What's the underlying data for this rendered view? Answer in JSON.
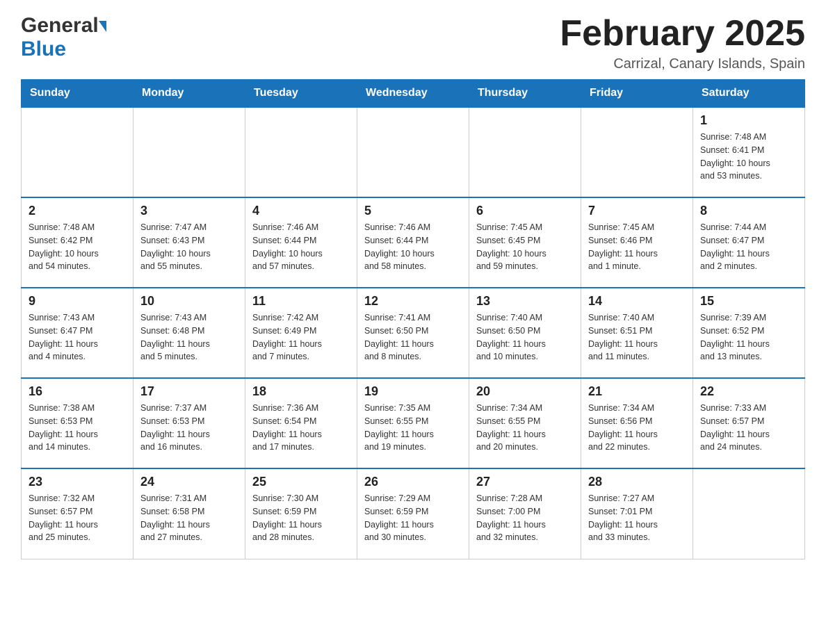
{
  "header": {
    "logo_general": "General",
    "logo_blue": "Blue",
    "title": "February 2025",
    "subtitle": "Carrizal, Canary Islands, Spain"
  },
  "days_of_week": [
    "Sunday",
    "Monday",
    "Tuesday",
    "Wednesday",
    "Thursday",
    "Friday",
    "Saturday"
  ],
  "weeks": [
    [
      {
        "day": "",
        "info": ""
      },
      {
        "day": "",
        "info": ""
      },
      {
        "day": "",
        "info": ""
      },
      {
        "day": "",
        "info": ""
      },
      {
        "day": "",
        "info": ""
      },
      {
        "day": "",
        "info": ""
      },
      {
        "day": "1",
        "info": "Sunrise: 7:48 AM\nSunset: 6:41 PM\nDaylight: 10 hours\nand 53 minutes."
      }
    ],
    [
      {
        "day": "2",
        "info": "Sunrise: 7:48 AM\nSunset: 6:42 PM\nDaylight: 10 hours\nand 54 minutes."
      },
      {
        "day": "3",
        "info": "Sunrise: 7:47 AM\nSunset: 6:43 PM\nDaylight: 10 hours\nand 55 minutes."
      },
      {
        "day": "4",
        "info": "Sunrise: 7:46 AM\nSunset: 6:44 PM\nDaylight: 10 hours\nand 57 minutes."
      },
      {
        "day": "5",
        "info": "Sunrise: 7:46 AM\nSunset: 6:44 PM\nDaylight: 10 hours\nand 58 minutes."
      },
      {
        "day": "6",
        "info": "Sunrise: 7:45 AM\nSunset: 6:45 PM\nDaylight: 10 hours\nand 59 minutes."
      },
      {
        "day": "7",
        "info": "Sunrise: 7:45 AM\nSunset: 6:46 PM\nDaylight: 11 hours\nand 1 minute."
      },
      {
        "day": "8",
        "info": "Sunrise: 7:44 AM\nSunset: 6:47 PM\nDaylight: 11 hours\nand 2 minutes."
      }
    ],
    [
      {
        "day": "9",
        "info": "Sunrise: 7:43 AM\nSunset: 6:47 PM\nDaylight: 11 hours\nand 4 minutes."
      },
      {
        "day": "10",
        "info": "Sunrise: 7:43 AM\nSunset: 6:48 PM\nDaylight: 11 hours\nand 5 minutes."
      },
      {
        "day": "11",
        "info": "Sunrise: 7:42 AM\nSunset: 6:49 PM\nDaylight: 11 hours\nand 7 minutes."
      },
      {
        "day": "12",
        "info": "Sunrise: 7:41 AM\nSunset: 6:50 PM\nDaylight: 11 hours\nand 8 minutes."
      },
      {
        "day": "13",
        "info": "Sunrise: 7:40 AM\nSunset: 6:50 PM\nDaylight: 11 hours\nand 10 minutes."
      },
      {
        "day": "14",
        "info": "Sunrise: 7:40 AM\nSunset: 6:51 PM\nDaylight: 11 hours\nand 11 minutes."
      },
      {
        "day": "15",
        "info": "Sunrise: 7:39 AM\nSunset: 6:52 PM\nDaylight: 11 hours\nand 13 minutes."
      }
    ],
    [
      {
        "day": "16",
        "info": "Sunrise: 7:38 AM\nSunset: 6:53 PM\nDaylight: 11 hours\nand 14 minutes."
      },
      {
        "day": "17",
        "info": "Sunrise: 7:37 AM\nSunset: 6:53 PM\nDaylight: 11 hours\nand 16 minutes."
      },
      {
        "day": "18",
        "info": "Sunrise: 7:36 AM\nSunset: 6:54 PM\nDaylight: 11 hours\nand 17 minutes."
      },
      {
        "day": "19",
        "info": "Sunrise: 7:35 AM\nSunset: 6:55 PM\nDaylight: 11 hours\nand 19 minutes."
      },
      {
        "day": "20",
        "info": "Sunrise: 7:34 AM\nSunset: 6:55 PM\nDaylight: 11 hours\nand 20 minutes."
      },
      {
        "day": "21",
        "info": "Sunrise: 7:34 AM\nSunset: 6:56 PM\nDaylight: 11 hours\nand 22 minutes."
      },
      {
        "day": "22",
        "info": "Sunrise: 7:33 AM\nSunset: 6:57 PM\nDaylight: 11 hours\nand 24 minutes."
      }
    ],
    [
      {
        "day": "23",
        "info": "Sunrise: 7:32 AM\nSunset: 6:57 PM\nDaylight: 11 hours\nand 25 minutes."
      },
      {
        "day": "24",
        "info": "Sunrise: 7:31 AM\nSunset: 6:58 PM\nDaylight: 11 hours\nand 27 minutes."
      },
      {
        "day": "25",
        "info": "Sunrise: 7:30 AM\nSunset: 6:59 PM\nDaylight: 11 hours\nand 28 minutes."
      },
      {
        "day": "26",
        "info": "Sunrise: 7:29 AM\nSunset: 6:59 PM\nDaylight: 11 hours\nand 30 minutes."
      },
      {
        "day": "27",
        "info": "Sunrise: 7:28 AM\nSunset: 7:00 PM\nDaylight: 11 hours\nand 32 minutes."
      },
      {
        "day": "28",
        "info": "Sunrise: 7:27 AM\nSunset: 7:01 PM\nDaylight: 11 hours\nand 33 minutes."
      },
      {
        "day": "",
        "info": ""
      }
    ]
  ]
}
